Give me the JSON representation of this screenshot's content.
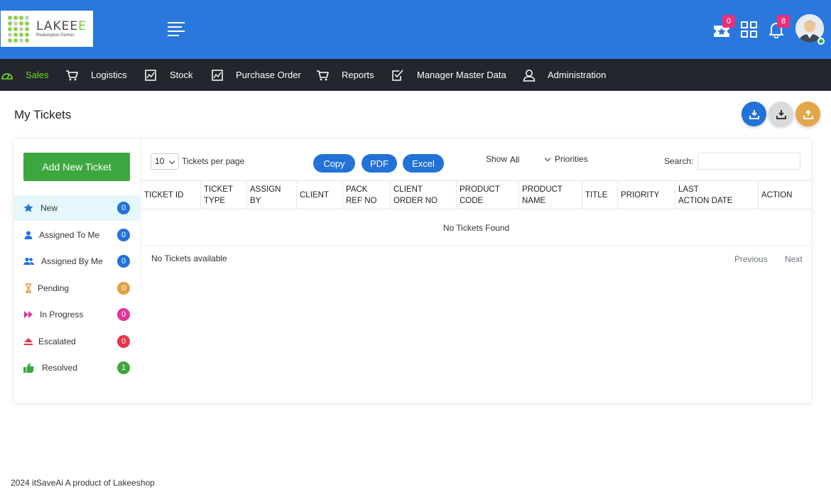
{
  "logo": {
    "title_main": "LAKEE",
    "title_accent": "E",
    "subtitle": "Redemption Partner"
  },
  "topbar": {
    "rewards_badge": "0",
    "notifications_badge": "8",
    "colors": {
      "bar": "#2a78de",
      "badge": "#e8317b"
    }
  },
  "nav": {
    "items": [
      {
        "label": "Sales",
        "icon": "dashboard-gauge-icon",
        "active": true
      },
      {
        "label": "Logistics",
        "icon": "cart-icon"
      },
      {
        "label": "Stock",
        "icon": "image-chart-icon"
      },
      {
        "label": "Purchase Order",
        "icon": "image-chart-icon"
      },
      {
        "label": "Reports",
        "icon": "cart-icon"
      },
      {
        "label": "Manager Master Data",
        "icon": "checkbox-icon"
      },
      {
        "label": "Administration",
        "icon": "user-icon"
      }
    ]
  },
  "page": {
    "title": "My Tickets"
  },
  "sidebar": {
    "add_button": "Add New Ticket",
    "items": [
      {
        "label": "New",
        "count": "0",
        "icon": "star-icon",
        "color": "#2272d9"
      },
      {
        "label": "Assigned To Me",
        "count": "0",
        "icon": "user-icon",
        "color": "#2272d9"
      },
      {
        "label": "Assigned By Me",
        "count": "0",
        "icon": "users-icon",
        "color": "#2272d9"
      },
      {
        "label": "Pending",
        "count": "0",
        "icon": "hourglass-icon",
        "color": "#e2a03f"
      },
      {
        "label": "In Progress",
        "count": "0",
        "icon": "fast-forward-icon",
        "color": "#e0359a"
      },
      {
        "label": "Escalated",
        "count": "0",
        "icon": "eject-icon",
        "color": "#e8344b"
      },
      {
        "label": "Resolved",
        "count": "1",
        "icon": "thumbs-up-icon",
        "color": "#3da73f"
      }
    ]
  },
  "toolbar": {
    "page_size": "10",
    "per_page_label": "Tickets per page",
    "copy": "Copy",
    "pdf": "PDF",
    "excel": "Excel",
    "show_label": "Show",
    "show_value": "All",
    "priorities_label": "Priorities",
    "search_label": "Search:",
    "search_value": ""
  },
  "table": {
    "headers": [
      [
        "TICKET ID"
      ],
      [
        "TICKET",
        "TYPE"
      ],
      [
        "ASSIGN",
        "BY"
      ],
      [
        "CLIENT"
      ],
      [
        "PACK",
        "REF NO"
      ],
      [
        "CLIENT",
        "ORDER NO"
      ],
      [
        "PRODUCT",
        "CODE"
      ],
      [
        "PRODUCT",
        "NAME"
      ],
      [
        "TITLE"
      ],
      [
        "PRIORITY"
      ],
      [
        "LAST",
        "ACTION DATE"
      ],
      [
        "ACTION"
      ]
    ],
    "empty_message": "No Tickets Found",
    "info": "No Tickets available",
    "previous": "Previous",
    "next": "Next"
  },
  "footer": {
    "text": "2024 itSaveAi A product of Lakeeshop"
  }
}
